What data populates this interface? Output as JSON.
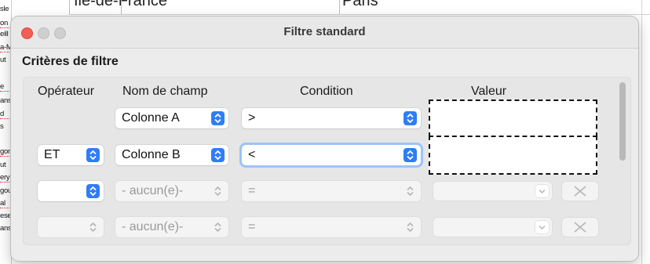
{
  "background": {
    "top_cells": [
      "Île-de-France",
      "Paris"
    ],
    "left_column_fragments": [
      "sle",
      "on",
      "eill",
      "a-M",
      "ut",
      "e",
      "ans",
      "d",
      "s",
      "gon",
      "ut",
      "ery",
      "gou",
      "al",
      "ese",
      "ans"
    ]
  },
  "dialog": {
    "title": "Filtre standard",
    "section_title": "Critères de filtre",
    "headers": {
      "operator": "Opérateur",
      "field": "Nom de champ",
      "condition": "Condition",
      "value": "Valeur"
    },
    "rows": [
      {
        "operator": "",
        "field": "Colonne A",
        "condition": ">",
        "value": ""
      },
      {
        "operator": "ET",
        "field": "Colonne B",
        "condition": "<",
        "value": ""
      },
      {
        "operator": "",
        "field": "- aucun(e)-",
        "condition": "=",
        "value": ""
      },
      {
        "operator": "",
        "field": "- aucun(e)-",
        "condition": "=",
        "value": ""
      }
    ]
  },
  "colors": {
    "accent": "#2f7df6",
    "close_button": "#f05e55",
    "focus_ring": "#9cc3fb"
  },
  "icons": [
    "stepper-icon",
    "remove-icon",
    "close-icon"
  ]
}
